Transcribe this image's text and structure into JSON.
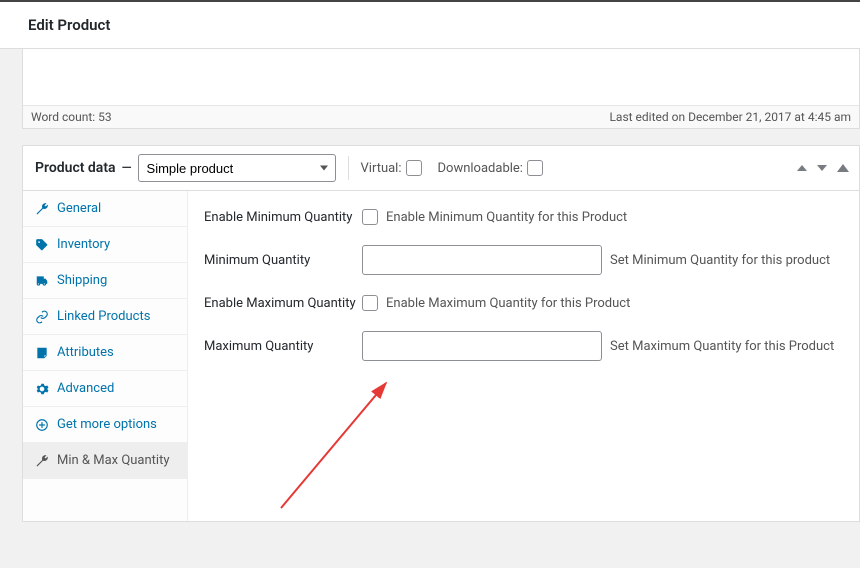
{
  "page_title": "Edit Product",
  "status": {
    "word_count_label": "Word count: 53",
    "last_edited": "Last edited on December 21, 2017 at 4:45 am"
  },
  "metabox": {
    "title": "Product data",
    "dash": "—",
    "type_selected": "Simple product",
    "virtual_label": "Virtual:",
    "downloadable_label": "Downloadable:"
  },
  "tabs": {
    "general": "General",
    "inventory": "Inventory",
    "shipping": "Shipping",
    "linked": "Linked Products",
    "attributes": "Attributes",
    "advanced": "Advanced",
    "get_more": "Get more options",
    "minmax": "Min & Max Quantity"
  },
  "form": {
    "enable_min_label": "Enable Minimum Quantity",
    "enable_min_desc": "Enable Minimum Quantity for this Product",
    "min_qty_label": "Minimum Quantity",
    "min_qty_desc": "Set Minimum Quantity for this product",
    "enable_max_label": "Enable Maximum Quantity",
    "enable_max_desc": "Enable Maximum Quantity for this Product",
    "max_qty_label": "Maximum Quantity",
    "max_qty_desc": "Set Maximum Quantity for this Product"
  }
}
